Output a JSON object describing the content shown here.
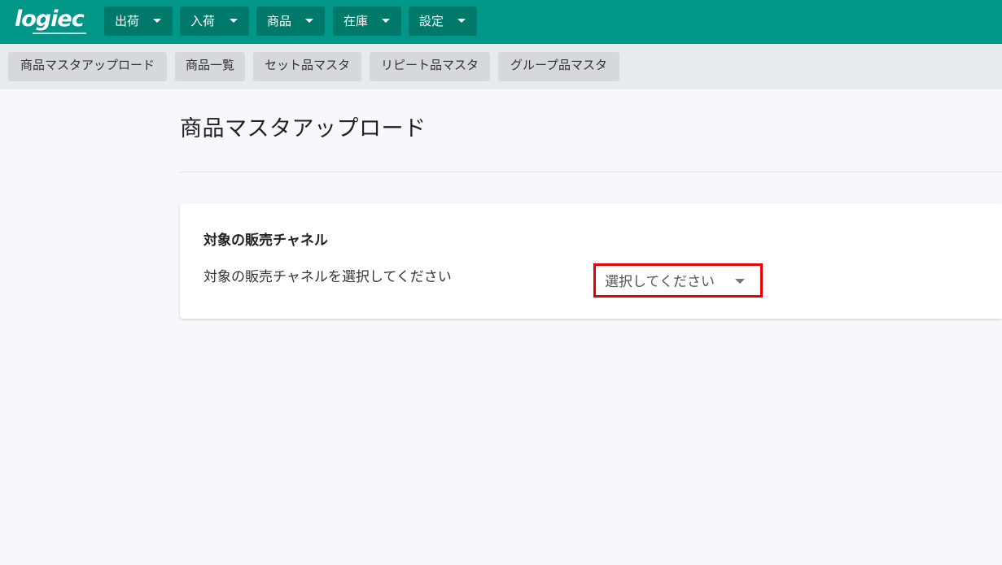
{
  "logo": {
    "text": "logiec"
  },
  "topnav": {
    "items": [
      {
        "label": "出荷"
      },
      {
        "label": "入荷"
      },
      {
        "label": "商品"
      },
      {
        "label": "在庫"
      },
      {
        "label": "設定"
      }
    ]
  },
  "subnav": {
    "items": [
      {
        "label": "商品マスタアップロード"
      },
      {
        "label": "商品一覧"
      },
      {
        "label": "セット品マスタ"
      },
      {
        "label": "リピート品マスタ"
      },
      {
        "label": "グループ品マスタ"
      }
    ]
  },
  "page": {
    "title": "商品マスタアップロード"
  },
  "card": {
    "title": "対象の販売チャネル",
    "label": "対象の販売チャネルを選択してください",
    "select": {
      "selected": "選択してください"
    }
  },
  "colors": {
    "header": "#009688",
    "nav_button": "#00796b",
    "highlight": "#e60000"
  }
}
